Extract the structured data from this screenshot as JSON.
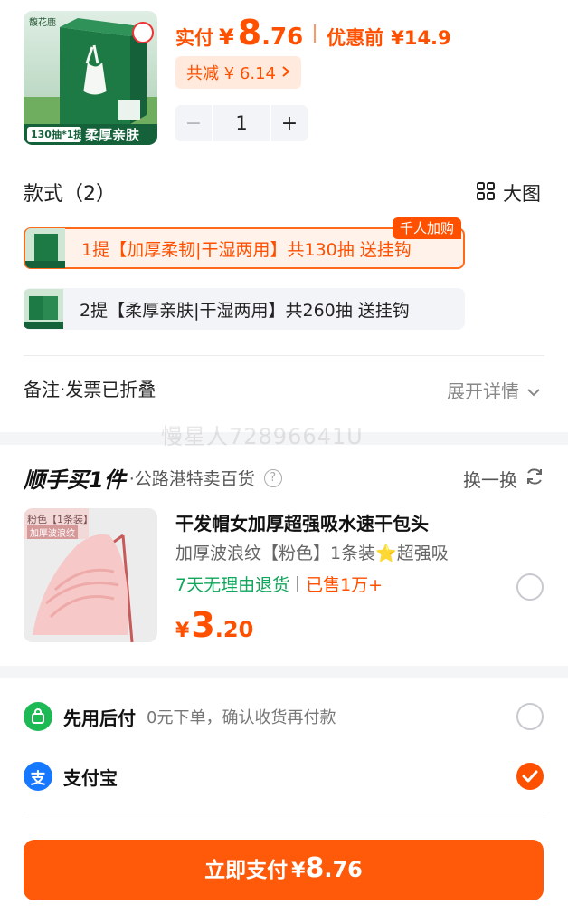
{
  "product": {
    "brand_logo_text": "馥花鹿",
    "image_banner_left": "130抽*1提",
    "image_banner_right": "柔厚亲肤",
    "paid_label": "实付",
    "currency": "¥",
    "price_int": "8",
    "price_dec": ".76",
    "before_discount_label": "优惠前",
    "before_discount_price": "¥14.9",
    "total_discount": "共减 ¥ 6.14",
    "quantity": "1",
    "minus": "−",
    "plus": "+"
  },
  "styles": {
    "title": "款式（2）",
    "big_view_label": "大图",
    "badge": "千人加购",
    "options": [
      {
        "label": "1提【加厚柔韧|干湿两用】共130抽 送挂钩",
        "selected": true
      },
      {
        "label": "2提【柔厚亲肤|干湿两用】共260抽 送挂钩",
        "selected": false
      }
    ]
  },
  "note": {
    "label": "备注·发票已折叠",
    "expand_label": "展开详情"
  },
  "watermark": "慢星人72896641U",
  "addon": {
    "brand": "顺手买1件",
    "shop": "·公路港特卖百货",
    "swap_label": "换一换",
    "item": {
      "image_tag": "粉色【1条装】",
      "image_tag2": "加厚波浪纹",
      "title": "干发帽女加厚超强吸水速干包头",
      "spec": "加厚波浪纹【粉色】1条装⭐超强吸",
      "return_policy": "7天无理由退货",
      "sold": "已售1万+",
      "currency": "¥",
      "price_int": "3",
      "price_dec": ".20"
    }
  },
  "payment": {
    "methods": [
      {
        "name": "先用后付",
        "desc": "0元下单，确认收货再付款",
        "selected": false,
        "color": "#1db954"
      },
      {
        "name": "支付宝",
        "desc": "",
        "selected": true,
        "color": "#1677ff"
      }
    ],
    "pay_button_label": "立即支付",
    "pay_currency": "¥",
    "pay_int": "8",
    "pay_dec": ".76"
  },
  "colors": {
    "accent": "#ff5000",
    "green": "#11a65b"
  }
}
